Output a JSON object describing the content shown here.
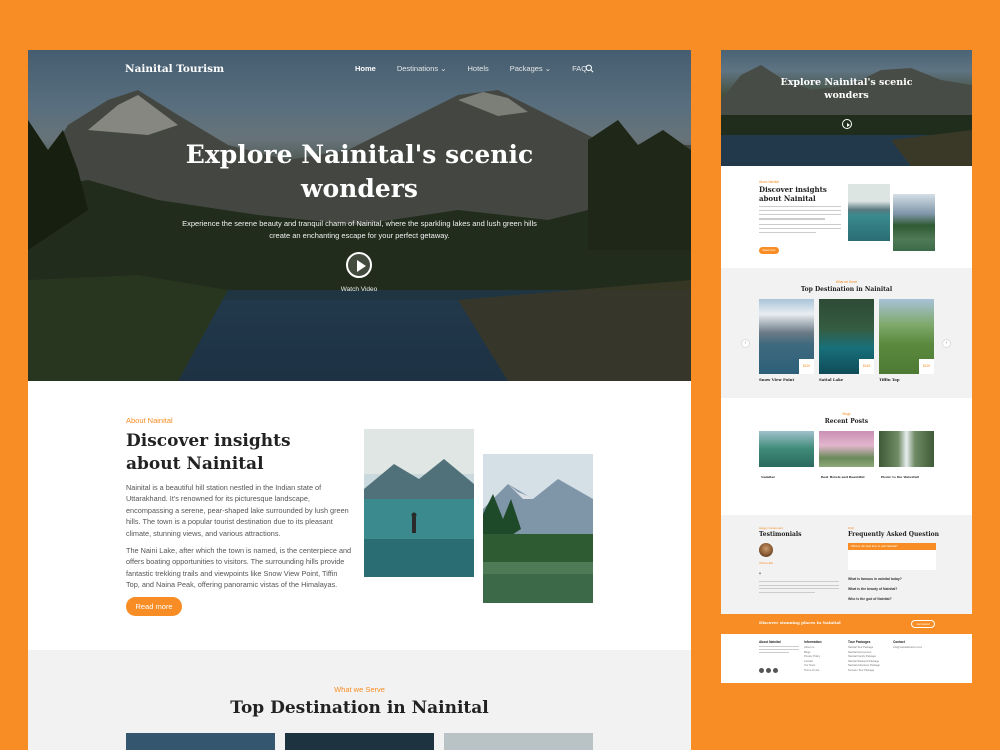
{
  "desktop": {
    "nav": {
      "brand": "Nainital Tourism",
      "links": [
        {
          "label": "Home"
        },
        {
          "label": "Destinations ⌄"
        },
        {
          "label": "Hotels"
        },
        {
          "label": "Packages ⌄"
        },
        {
          "label": "FAQ"
        }
      ],
      "search_icon": "search-icon"
    },
    "hero": {
      "title": "Explore Nainital's scenic wonders",
      "subtitle": "Experience the serene beauty and tranquil charm of Nainital, where the sparkling lakes and lush green hills create an enchanting escape for your perfect getaway.",
      "watch_label": "Watch Video",
      "play_icon": "play-icon"
    },
    "about": {
      "eyebrow": "About Nainital",
      "title": "Discover insights about Nainital",
      "para1": "Nainital is a beautiful hill station nestled in the Indian state of Uttarakhand. It's renowned for its picturesque landscape, encompassing a serene, pear-shaped lake surrounded by lush green hills. The town is a popular tourist destination due to its pleasant climate, stunning views, and various attractions.",
      "para2": "The Naini Lake, after which the town is named, is the centerpiece and offers boating opportunities to visitors. The surrounding hills provide fantastic trekking trails and viewpoints like Snow View Point, Tiffin Top, and Naina Peak, offering panoramic vistas of the Himalayas.",
      "button": "Read more"
    },
    "serve": {
      "eyebrow": "What we Serve",
      "title": "Top Destination in Nainital"
    }
  },
  "mobile": {
    "hero": {
      "title": "Explore Nainital's scenic wonders"
    },
    "about": {
      "eyebrow": "About Nainital",
      "title": "Discover insights about Nainital",
      "button": "Read more"
    },
    "destinations": {
      "eyebrow": "What we Serve",
      "title": "Top Destination in Nainital",
      "cards": [
        {
          "name": "Snow View Point",
          "price": "$120"
        },
        {
          "name": "Sattal Lake",
          "price": "$145"
        },
        {
          "name": "Tiffin Top",
          "price": "$125"
        }
      ]
    },
    "posts": {
      "eyebrow": "Blogs",
      "title": "Recent Posts",
      "items": [
        {
          "title": "Nainital"
        },
        {
          "title": "Best Hotels and Beautiful"
        },
        {
          "title": "Picnic to the Waterfall"
        }
      ]
    },
    "testimonials": {
      "eyebrow": "Happy Customers",
      "title": "Testimonials",
      "person": "Olivia Hills"
    },
    "faq": {
      "eyebrow": "FAQ",
      "title": "Frequently Asked Question",
      "questions": [
        "What is the best time to visit Nainital?",
        "What is famous in nainital today?",
        "What is the beauty of Nainital?",
        "Who is the god of Nainital?"
      ]
    },
    "cta": {
      "text": "Discover stunning places in Nainital",
      "button": "Get started"
    },
    "footer": {
      "cols": [
        {
          "heading": "About Nainital",
          "links": []
        },
        {
          "heading": "Information",
          "links": [
            "About us",
            "Blogs",
            "Privacy Policy",
            "Contact",
            "Our Tours",
            "Terms of Use"
          ]
        },
        {
          "heading": "Tour Packages",
          "links": [
            "Nainital Tour Package",
            "Nainital Honeymoon",
            "Nainital Family Package",
            "Nainital Weekend Package",
            "Nainital Adventure Package",
            "Kumaon Tour Package"
          ]
        },
        {
          "heading": "Contact",
          "links": [
            "info@nainitaltourism.com"
          ]
        }
      ]
    }
  },
  "colors": {
    "accent": "#f78d24",
    "background": "#f78d24",
    "section_gray": "#f2f2f2"
  }
}
